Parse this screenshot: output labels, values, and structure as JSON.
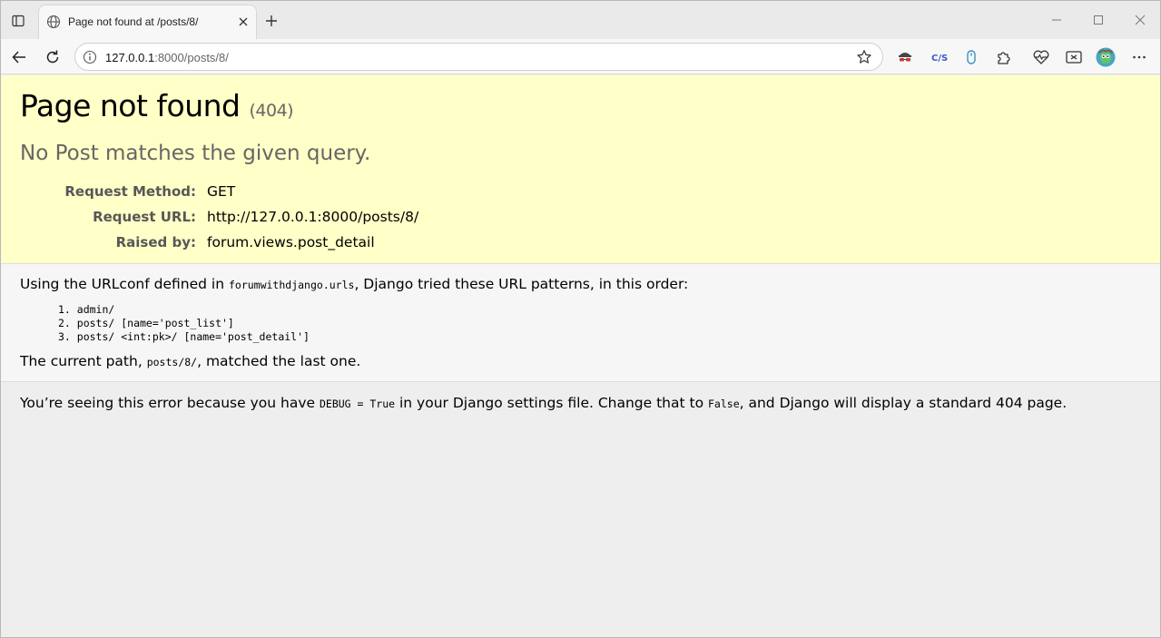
{
  "browser": {
    "tab": {
      "title": "Page not found at /posts/8/"
    },
    "address_bar": {
      "host": "127.0.0.1",
      "rest": ":8000/posts/8/"
    }
  },
  "page": {
    "title": "Page not found",
    "status_code": "(404)",
    "subtitle": "No Post matches the given query.",
    "request_meta": [
      {
        "key": "Request Method:",
        "value": "GET"
      },
      {
        "key": "Request URL:",
        "value": "http://127.0.0.1:8000/posts/8/"
      },
      {
        "key": "Raised by:",
        "value": "forum.views.post_detail"
      }
    ],
    "urlconf_text_1": "Using the URLconf defined in ",
    "urlconf_module": "forumwithdjango.urls",
    "urlconf_text_2": ", Django tried these URL patterns, in this order:",
    "patterns": [
      "1. admin/",
      "2. posts/ [name='post_list']",
      "3. posts/ <int:pk>/ [name='post_detail']"
    ],
    "current_path_text_1": "The current path, ",
    "current_path": "posts/8/",
    "current_path_text_2": ", matched the last one.",
    "explanation_1": "You’re seeing this error because you have ",
    "explanation_debug": "DEBUG = True",
    "explanation_2": " in your Django settings file. Change that to ",
    "explanation_false": "False",
    "explanation_3": ", and Django will display a standard 404 page."
  }
}
